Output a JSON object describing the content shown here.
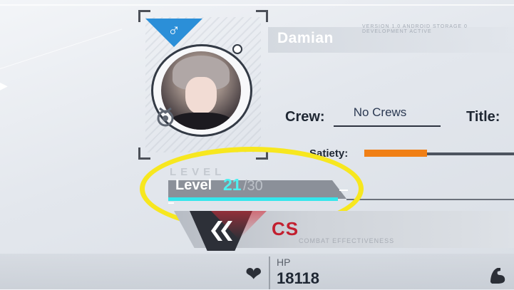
{
  "profile": {
    "gender_symbol": "♂",
    "name": "Damian",
    "micro_text": "VERSION 1.0 ANDROID STORAGE 0 DEVELOPMENT ACTIVE",
    "crew_label": "Crew:",
    "crew_value": "No Crews",
    "title_label": "Title:",
    "satiety_label": "Satiety:",
    "satiety_fraction": 0.45
  },
  "level": {
    "watermark": "LEVEL",
    "label": "Level",
    "current": "21",
    "max": "/30",
    "xp_fraction": 1.0
  },
  "combat": {
    "value": "CS",
    "label": "COMBAT EFFECTIVENESS"
  },
  "stats": {
    "hp_label": "HP",
    "hp_value": "18118"
  },
  "colors": {
    "gender_badge": "#2b8fd8",
    "satiety": "#f07f15",
    "level_accent": "#4ff0f0",
    "highlight": "#f7e71f",
    "combat": "#c21f2f"
  },
  "icons": {
    "gender": "male-icon",
    "crew_badge": "crew-badge-icon",
    "heart": "heart-icon",
    "strength": "muscle-icon"
  }
}
